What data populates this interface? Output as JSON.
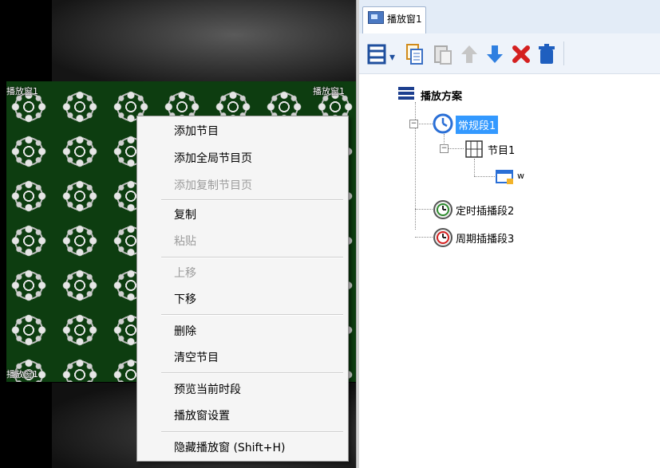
{
  "preview": {
    "window_label_top_left": "播放窗1",
    "window_label_top_right": "播放窗1",
    "window_label_bottom_left": "播放窗1"
  },
  "context_menu": {
    "items": [
      {
        "label": "添加节目",
        "enabled": true
      },
      {
        "label": "添加全局节目页",
        "enabled": true
      },
      {
        "label": "添加复制节目页",
        "enabled": false
      },
      {
        "label": "复制",
        "enabled": true
      },
      {
        "label": "粘贴",
        "enabled": false
      },
      {
        "label": "上移",
        "enabled": false
      },
      {
        "label": "下移",
        "enabled": true
      },
      {
        "label": "删除",
        "enabled": true
      },
      {
        "label": "清空节目",
        "enabled": true
      },
      {
        "label": "预览当前时段",
        "enabled": true
      },
      {
        "label": "播放窗设置",
        "enabled": true
      },
      {
        "label": "隐藏播放窗 (Shift+H)",
        "enabled": true
      }
    ]
  },
  "right_panel": {
    "tab_label": "播放窗1",
    "toolbar": {
      "icons": [
        "layout-icon",
        "dropdown-arrow-icon",
        "copy-icon",
        "paste-icon",
        "move-up-icon",
        "move-down-icon",
        "delete-x-icon",
        "trash-icon"
      ]
    },
    "tree": {
      "root": "播放方案",
      "segment1": "常规段1",
      "program1": "节目1",
      "item_w": "w",
      "segment2": "定时插播段2",
      "segment3": "周期插播段3"
    }
  },
  "colors": {
    "selection": "#3399ff",
    "canvas_bg": "#0d3d10",
    "tabstrip": "#e3ecf7"
  }
}
